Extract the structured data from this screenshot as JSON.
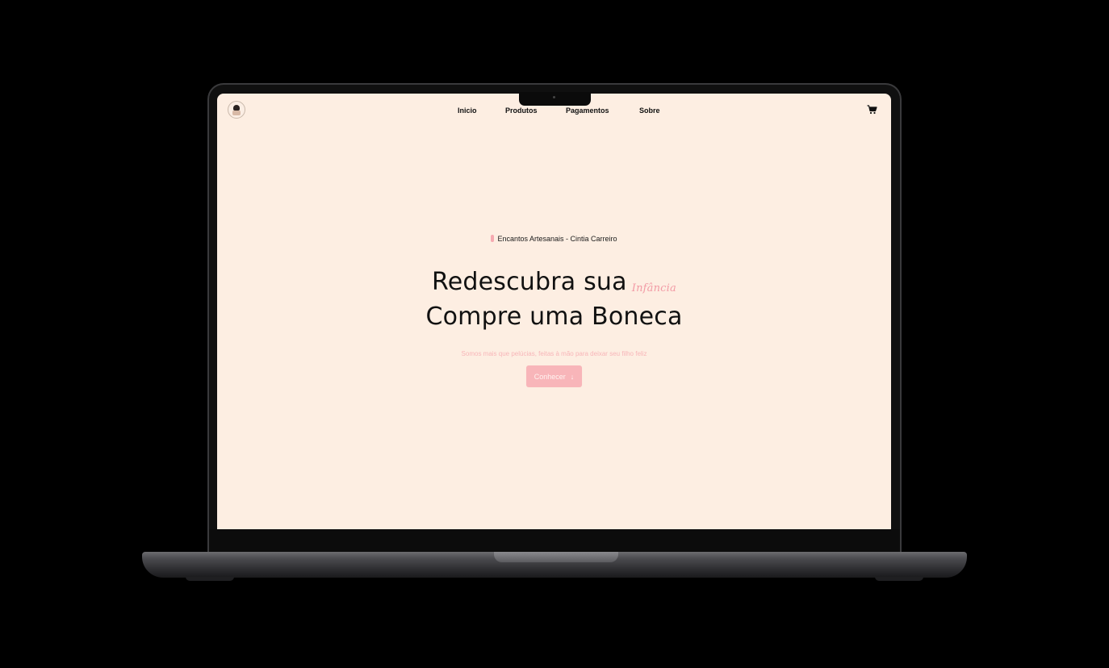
{
  "header": {
    "logo_icon": "doll-logo-icon",
    "nav": [
      {
        "label": "Inicio"
      },
      {
        "label": "Produtos"
      },
      {
        "label": "Pagamentos"
      },
      {
        "label": "Sobre"
      }
    ],
    "cart_icon": "shopping-cart-icon"
  },
  "hero": {
    "tag": "Encantos Artesanais - Cintia Carreiro",
    "headline_line1": "Redescubra sua",
    "headline_script": "Infância",
    "headline_line2": "Compre uma Boneca",
    "subtitle": "Somos mais que pelúcias, feitas à mão para deixar seu filho feliz",
    "cta_label": "Conhecer",
    "cta_arrow": "↓"
  },
  "colors": {
    "background": "#fdeee2",
    "accent": "#f8b5b9",
    "script": "#f29aa5",
    "text": "#111111"
  }
}
